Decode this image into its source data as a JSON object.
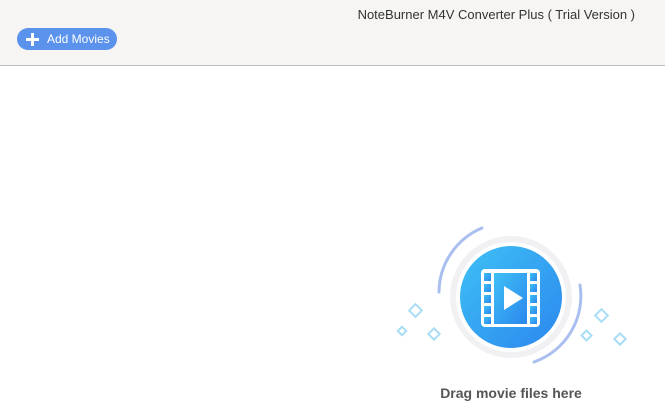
{
  "window": {
    "title": "NoteBurner M4V Converter Plus ( Trial Version )"
  },
  "toolbar": {
    "add_movies_label": "Add Movies",
    "add_movies_icon": "plus-icon"
  },
  "drop_zone": {
    "hint": "Drag movie files here",
    "icon": "video-play-icon",
    "colors": {
      "accent": "#5b92ec",
      "circle_light": "#3fc0f5",
      "circle_dark": "#2b87ee",
      "arc": "#a9bff0",
      "diamond": "#a9dcf5"
    }
  }
}
